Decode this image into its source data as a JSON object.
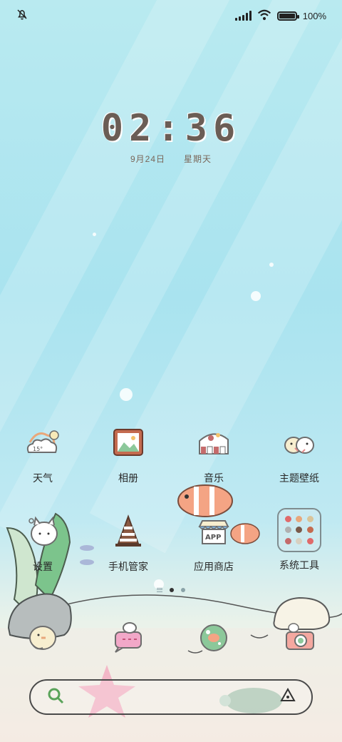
{
  "status_bar": {
    "silent_icon": "bell-slash-icon",
    "signal_icon": "signal-icon",
    "wifi_icon": "wifi-icon",
    "battery_icon": "battery-icon",
    "battery_level": 1.0,
    "battery_text": "100%"
  },
  "clock": {
    "time": "02:36",
    "date": "9月24日",
    "weekday": "星期天"
  },
  "apps_row1": [
    {
      "label": "天气",
      "icon": "weather-icon"
    },
    {
      "label": "相册",
      "icon": "gallery-icon"
    },
    {
      "label": "音乐",
      "icon": "music-icon"
    },
    {
      "label": "主题壁纸",
      "icon": "theme-icon"
    }
  ],
  "apps_row2": [
    {
      "label": "设置",
      "icon": "settings-icon"
    },
    {
      "label": "手机管家",
      "icon": "phone-manager-icon"
    },
    {
      "label": "应用商店",
      "icon": "app-store-icon"
    },
    {
      "label": "系统工具",
      "icon": "folder-icon"
    }
  ],
  "weather_temp": "15°",
  "app_store_badge": "APP",
  "page_indicator": {
    "pages": 2,
    "current": 1
  },
  "dock": [
    {
      "icon": "phone-icon"
    },
    {
      "icon": "messages-icon"
    },
    {
      "icon": "browser-icon"
    },
    {
      "icon": "camera-icon"
    }
  ],
  "search": {
    "search_icon": "search-icon",
    "assistant_icon": "assistant-icon"
  },
  "colors": {
    "clock": "#6b5d55",
    "label": "#2a2a2a"
  }
}
